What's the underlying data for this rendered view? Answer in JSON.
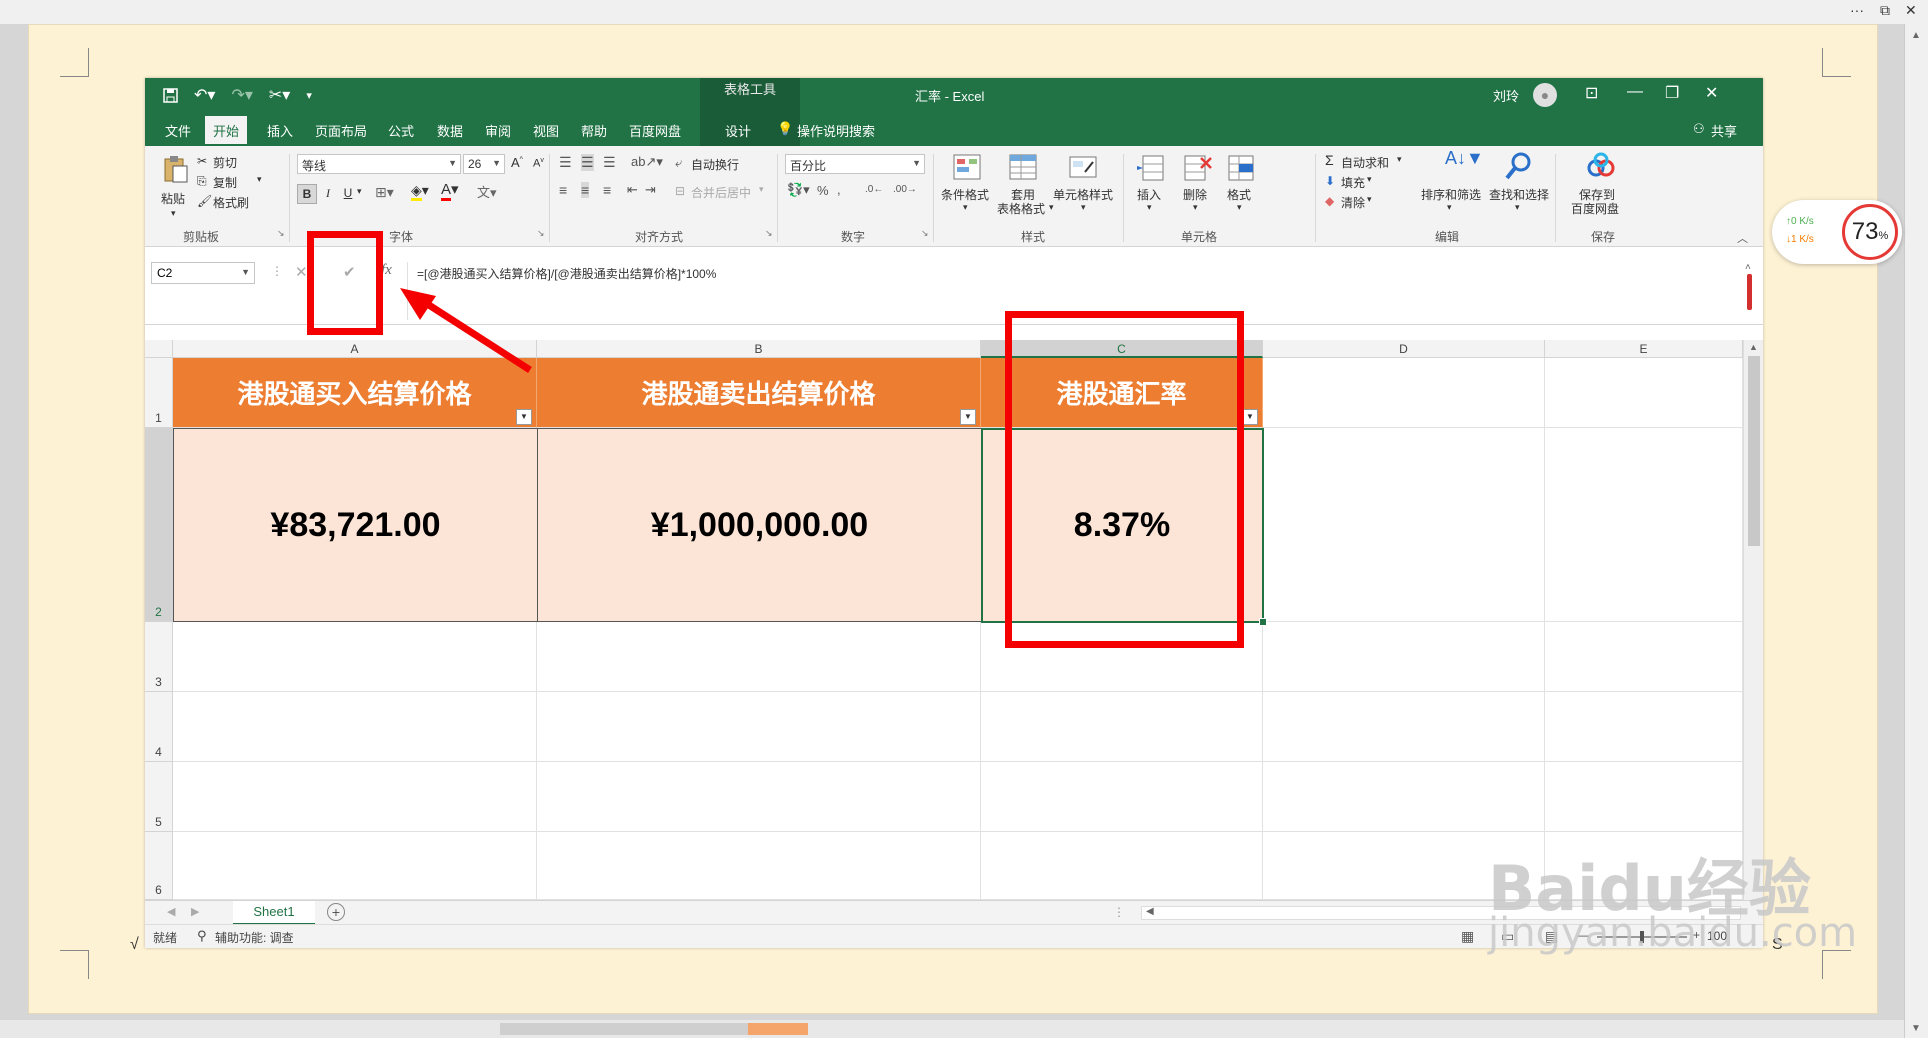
{
  "window": {
    "title": "汇率 - Excel",
    "context_tab_group": "表格工具",
    "user": "刘玲",
    "share_label": "共享"
  },
  "tabs": [
    "文件",
    "开始",
    "插入",
    "页面布局",
    "公式",
    "数据",
    "审阅",
    "视图",
    "帮助",
    "百度网盘",
    "设计"
  ],
  "active_tab": "开始",
  "tell_me": "操作说明搜索",
  "ribbon": {
    "clipboard": {
      "paste": "粘贴",
      "cut": "剪切",
      "copy": "复制",
      "format_painter": "格式刷",
      "label": "剪贴板"
    },
    "font": {
      "family": "等线",
      "size": "26",
      "label": "字体"
    },
    "alignment": {
      "wrap": "自动换行",
      "merge": "合并后居中",
      "label": "对齐方式"
    },
    "number": {
      "format": "百分比",
      "label": "数字"
    },
    "styles": {
      "conditional": "条件格式",
      "table_style_1": "套用",
      "table_style_2": "表格格式",
      "cell_style": "单元格样式",
      "label": "样式"
    },
    "cells": {
      "insert": "插入",
      "delete": "删除",
      "format": "格式",
      "label": "单元格"
    },
    "editing": {
      "autosum": "自动求和",
      "fill": "填充",
      "clear": "清除",
      "sort": "排序和筛选",
      "find": "查找和选择",
      "label": "编辑"
    },
    "save": {
      "line1": "保存到",
      "line2": "百度网盘",
      "label": "保存"
    }
  },
  "name_box": "C2",
  "formula": "=[@港股通买入结算价格]/[@港股通卖出结算价格]*100%",
  "columns": [
    "A",
    "B",
    "C",
    "D",
    "E"
  ],
  "rows": [
    "1",
    "2",
    "3",
    "4",
    "5",
    "6"
  ],
  "table": {
    "headers": [
      "港股通买入结算价格",
      "港股通卖出结算价格",
      "港股通汇率"
    ],
    "values": [
      "¥83,721.00",
      "¥1,000,000.00",
      "8.37%"
    ]
  },
  "sheet_tab": "Sheet1",
  "status": {
    "ready": "就绪",
    "accessibility": "辅助功能: 调查",
    "zoom": "100"
  },
  "overlay": {
    "net_up": "0  K/s",
    "net_down": "1  K/s",
    "cpu": "73",
    "cpu_unit": "%"
  },
  "watermark": {
    "brand": "Baidu经验",
    "url": "jingyan.baidu.com"
  },
  "colors": {
    "excel_green": "#217346",
    "header_orange": "#ed7d31",
    "data_fill": "#fce4d6",
    "annotation_red": "#f40000"
  }
}
